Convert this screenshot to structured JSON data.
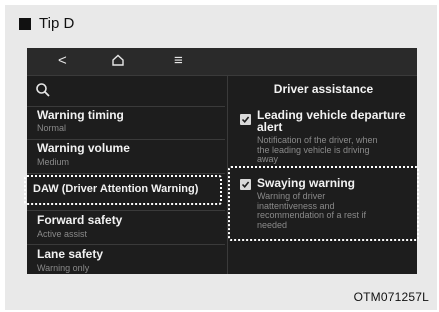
{
  "tip": {
    "label": "Tip D"
  },
  "nav": {
    "back_glyph": "<",
    "home_icon": "home-icon",
    "menu_glyph": "≡"
  },
  "left_menu": {
    "search_icon": "search-icon",
    "items": [
      {
        "title": "Warning timing",
        "subtitle": "Normal"
      },
      {
        "title": "Warning volume",
        "subtitle": "Medium"
      },
      {
        "title": "DAW (Driver Attention Warning)",
        "subtitle": ""
      },
      {
        "title": "Forward safety",
        "subtitle": "Active assist"
      },
      {
        "title": "Lane safety",
        "subtitle": "Warning only"
      }
    ]
  },
  "right_panel": {
    "title": "Driver assistance",
    "options": [
      {
        "title_lines": [
          "Leading vehicle departure",
          "alert"
        ],
        "desc_lines": [
          "Notification of the driver, when",
          "the leading vehicle is driving",
          "away"
        ],
        "checked": true
      },
      {
        "title_lines": [
          "Swaying warning"
        ],
        "desc_lines": [
          "Warning of driver",
          "inattentiveness and",
          "recommendation of a rest if",
          "needed"
        ],
        "checked": true
      }
    ]
  },
  "footer": {
    "code": "OTM071257L"
  },
  "colors": {
    "screen_bg": "#1d1d1d",
    "highlight_border": "#ffffff",
    "frame_bg": "#e9e9e9"
  }
}
